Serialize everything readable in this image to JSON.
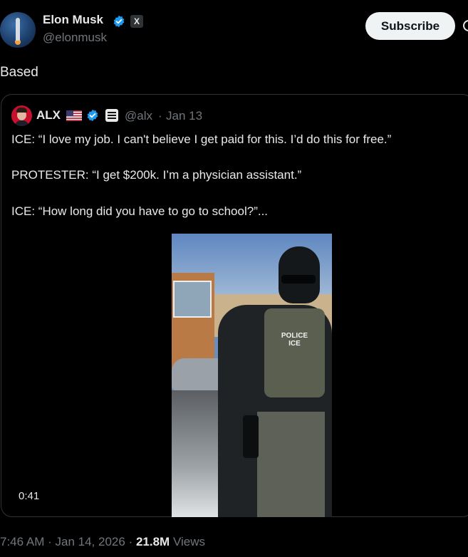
{
  "author": {
    "name": "Elon Musk",
    "handle": "@elonmusk",
    "badge_label": "X",
    "verified_color": "#1d9bf0"
  },
  "subscribe_label": "Subscribe",
  "tweet": {
    "text": "Based"
  },
  "quoted": {
    "name": "ALX",
    "handle": "@alx",
    "separator": "·",
    "date": "Jan 13",
    "lines": [
      "ICE: “I love my job. I can't believe I get paid for this. I’d do this for free.”",
      "PROTESTER: “I get $200k. I’m a physician assistant.”",
      "ICE: “How long did you have to go to school?”..."
    ],
    "video": {
      "duration": "0:41",
      "vest_text": "POLICE ICE"
    }
  },
  "meta": {
    "time": "7:46 AM",
    "sep1": "·",
    "date": "Jan 14, 2026",
    "sep2": "·",
    "views_count": "21.8M",
    "views_label": "Views"
  },
  "icons": [
    "verified-icon",
    "x-affiliate-icon",
    "us-flag-icon",
    "affiliate-badge-icon",
    "more-icon"
  ]
}
